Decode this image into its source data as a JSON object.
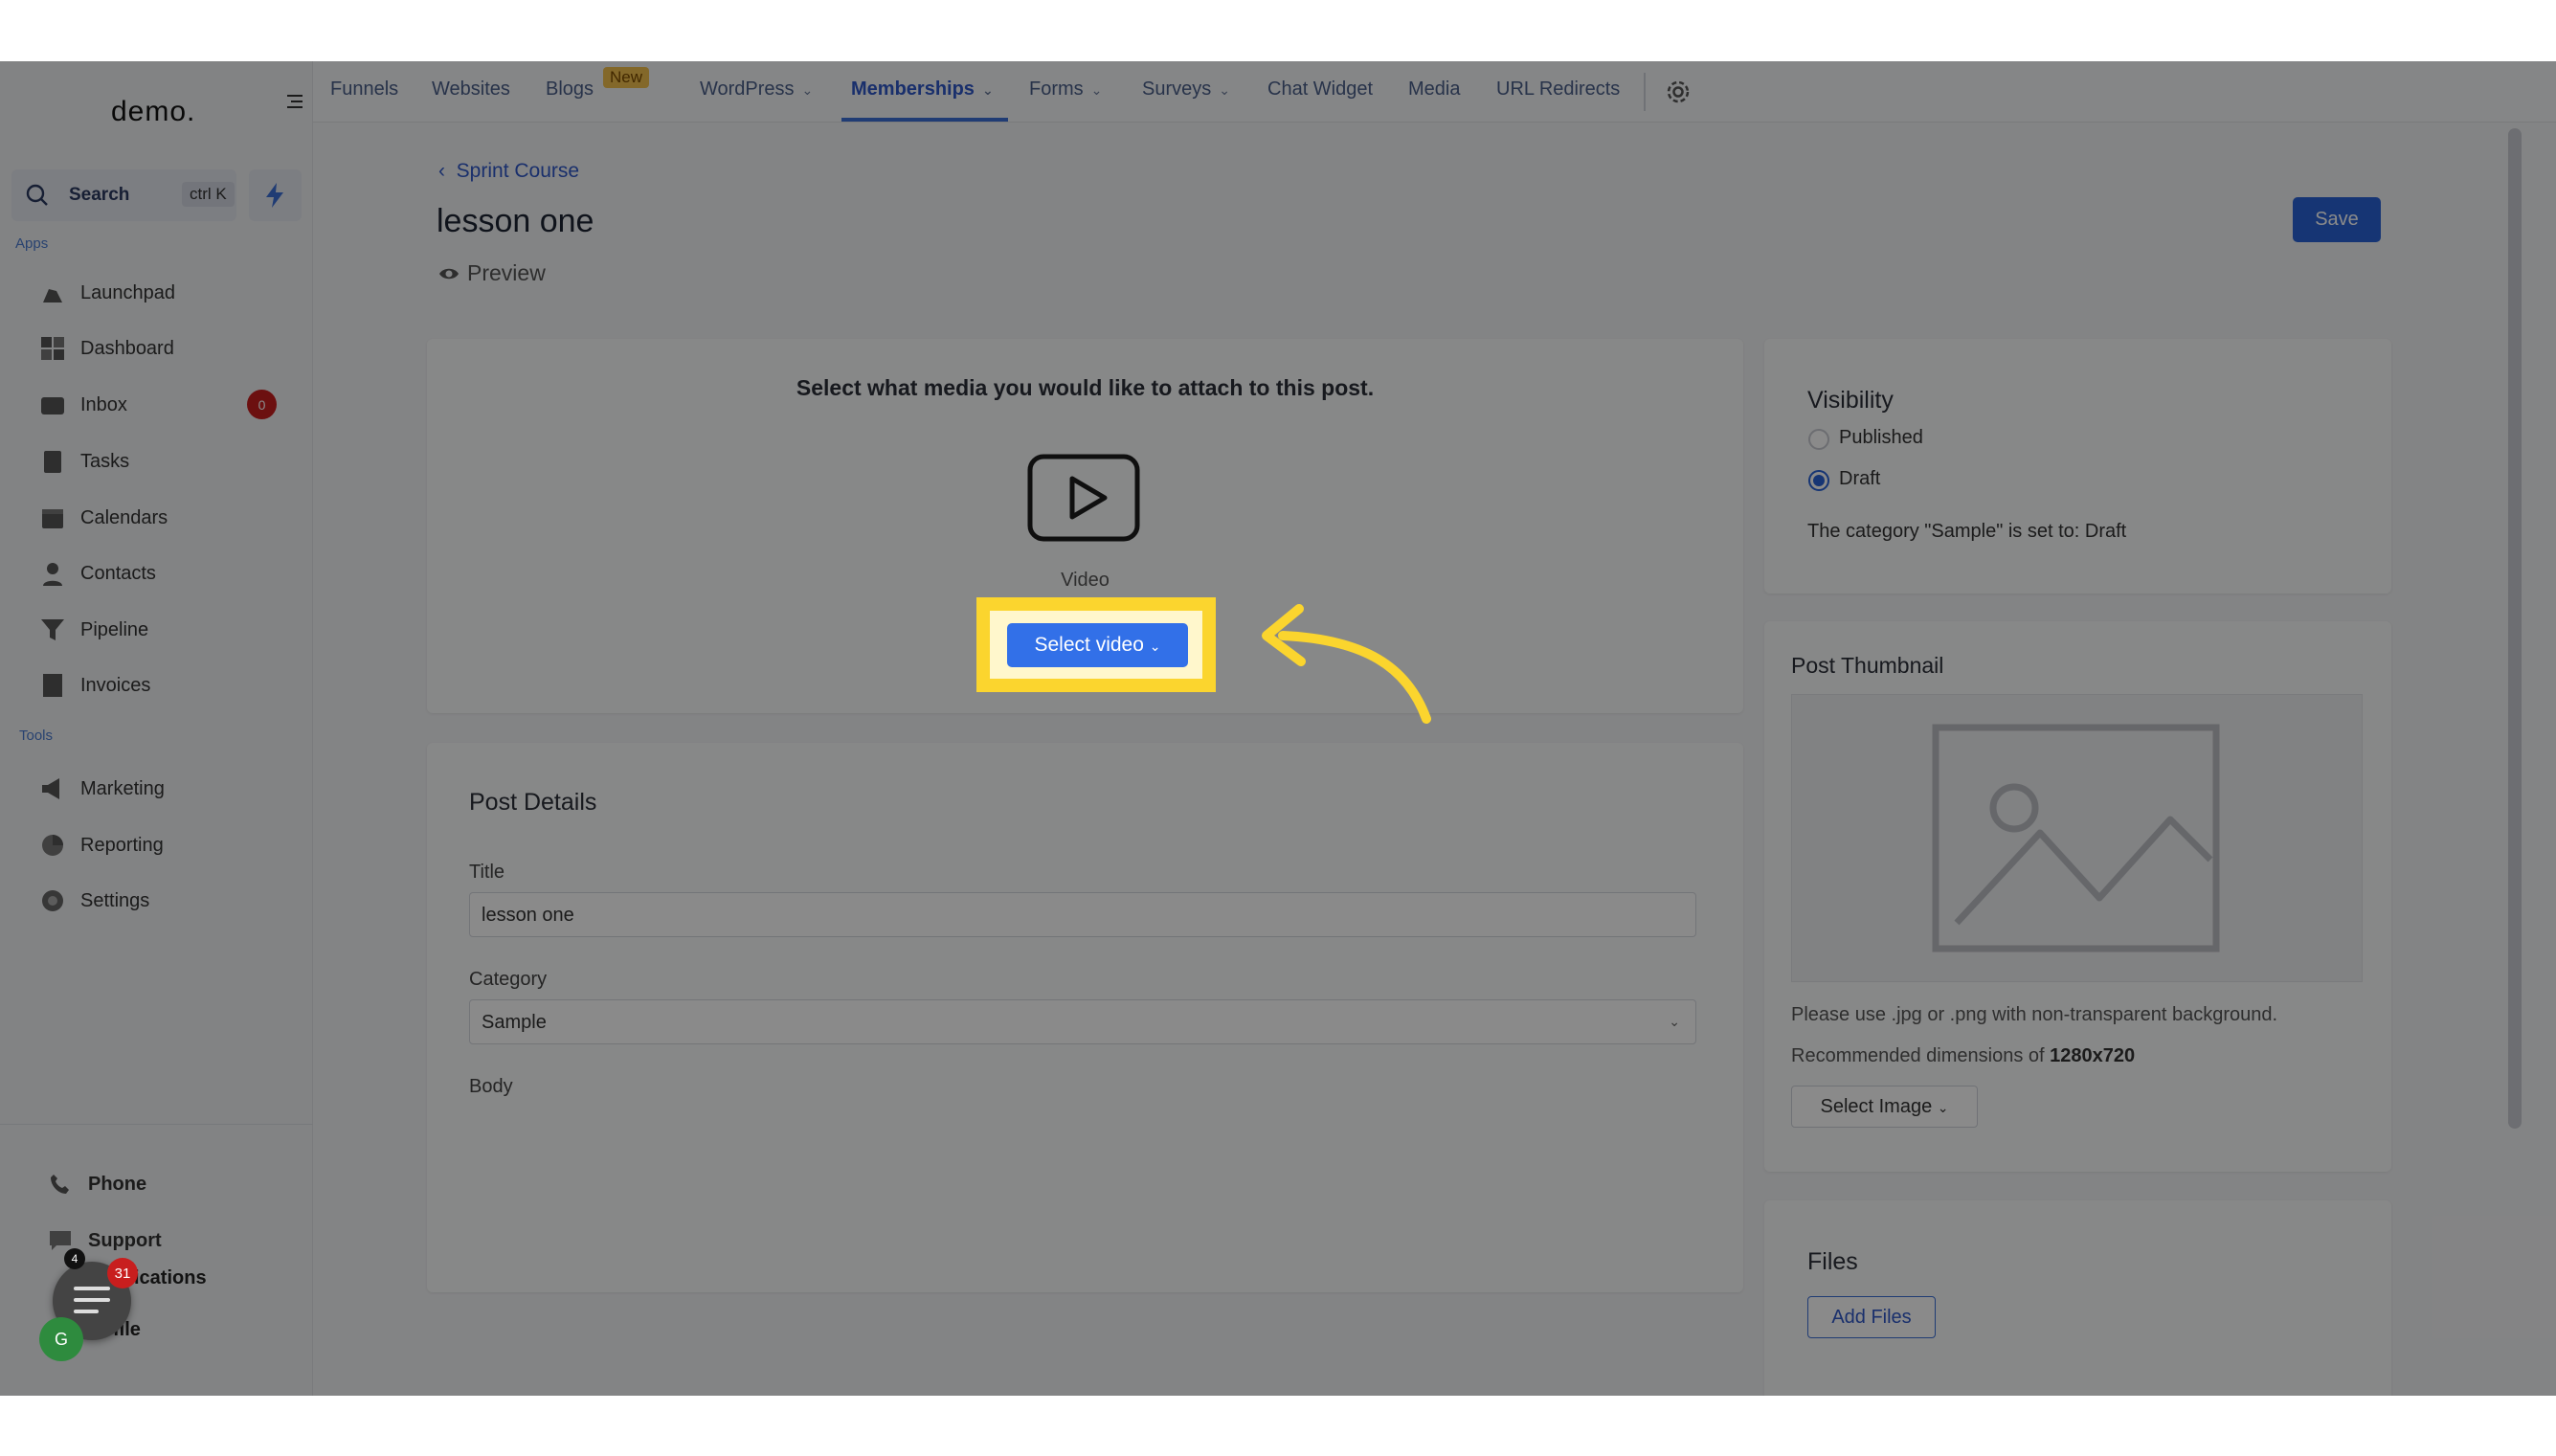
{
  "sidebar": {
    "logo": "demo.",
    "search": {
      "label": "Search",
      "shortcut": "ctrl K"
    },
    "apps_label": "Apps",
    "tools_label": "Tools",
    "apps": [
      {
        "label": "Launchpad",
        "icon": "rocket-icon"
      },
      {
        "label": "Dashboard",
        "icon": "grid-icon"
      },
      {
        "label": "Inbox",
        "icon": "inbox-icon",
        "badge": "0"
      },
      {
        "label": "Tasks",
        "icon": "clipboard-icon"
      },
      {
        "label": "Calendars",
        "icon": "calendar-icon"
      },
      {
        "label": "Contacts",
        "icon": "person-icon"
      },
      {
        "label": "Pipeline",
        "icon": "funnel-icon"
      },
      {
        "label": "Invoices",
        "icon": "invoice-icon"
      }
    ],
    "tools": [
      {
        "label": "Marketing",
        "icon": "megaphone-icon"
      },
      {
        "label": "Reporting",
        "icon": "pie-chart-icon"
      },
      {
        "label": "Settings",
        "icon": "gear-icon"
      }
    ],
    "bottom": {
      "phone": "Phone",
      "support": "Support",
      "notifications": "ications",
      "profile": "file",
      "avatar_initials": "G",
      "chat_badge": "31",
      "notif_badge": "4"
    }
  },
  "topnav": {
    "items": [
      {
        "label": "Funnels"
      },
      {
        "label": "Websites"
      },
      {
        "label": "Blogs",
        "badge": "New"
      },
      {
        "label": "WordPress",
        "dropdown": true
      },
      {
        "label": "Memberships",
        "dropdown": true,
        "active": true
      },
      {
        "label": "Forms",
        "dropdown": true
      },
      {
        "label": "Surveys",
        "dropdown": true
      },
      {
        "label": "Chat Widget"
      },
      {
        "label": "Media"
      },
      {
        "label": "URL Redirects"
      }
    ]
  },
  "page": {
    "back_link": "Sprint Course",
    "title": "lesson one",
    "preview": "Preview",
    "save": "Save"
  },
  "media": {
    "prompt": "Select what media you would like to attach to this post.",
    "video_label": "Video",
    "select_video": "Select video"
  },
  "post_details": {
    "heading": "Post Details",
    "title_label": "Title",
    "title_value": "lesson one",
    "category_label": "Category",
    "category_value": "Sample",
    "body_label": "Body"
  },
  "visibility": {
    "heading": "Visibility",
    "options": [
      "Published",
      "Draft"
    ],
    "selected": "Draft",
    "note": "The category \"Sample\" is set to: Draft"
  },
  "thumbnail": {
    "heading": "Post Thumbnail",
    "note1": "Please use .jpg or .png with non-transparent background.",
    "note2_prefix": "Recommended dimensions of ",
    "note2_value": "1280x720",
    "select_image": "Select Image"
  },
  "files": {
    "heading": "Files",
    "add_files": "Add Files"
  },
  "colors": {
    "accent": "#2a63d6",
    "highlight": "#fbd52e",
    "badge": "#c81e1e"
  }
}
